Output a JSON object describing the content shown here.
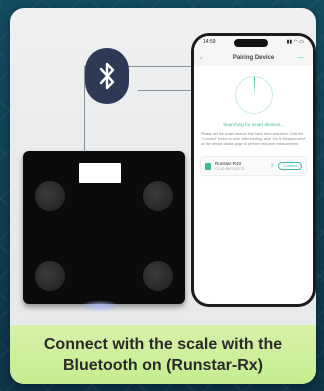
{
  "phone": {
    "status_time": "14:59",
    "status_right": "▮▮ ◠ ▭",
    "header_title": "Pairing Device",
    "searching_text": "Searching for smart devices...",
    "help_text": "Please set the smart devices that have been searched. Click the \"Connect\" button to bind. After binding, click \"Go to Measurement\" on the device details page to perform real-time measurement.",
    "device_name": "Runstar-R10",
    "device_mac": "C3:10:0B:F3:0D:7D",
    "connect_label": "Connect"
  },
  "caption": {
    "line1": "Connect with the scale with the",
    "line2": "Bluetooth on (Runstar-Rx)"
  },
  "colors": {
    "accent": "#3fb89a",
    "bluetooth_badge": "#2d3a55",
    "caption_bg": "#c6ec8f"
  },
  "icons": [
    "bluetooth-icon",
    "back-icon",
    "more-icon",
    "scale-device-icon",
    "bluetooth-mini-icon"
  ]
}
